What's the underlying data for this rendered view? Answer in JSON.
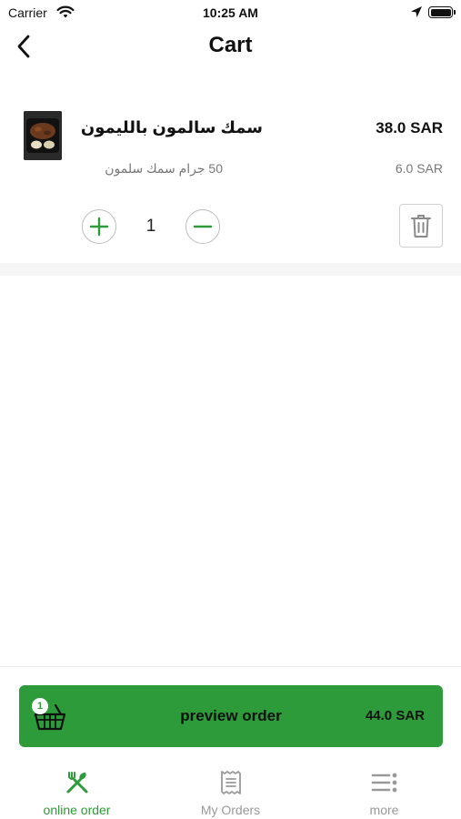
{
  "status_bar": {
    "carrier": "Carrier",
    "time": "10:25 AM",
    "icons": [
      "wifi-icon",
      "location-arrow-icon",
      "battery-icon"
    ]
  },
  "nav": {
    "title": "Cart",
    "back_icon": "chevron-left-icon"
  },
  "cart": {
    "items": [
      {
        "name": "سمك سالمون بالليمون",
        "price": "38.0 SAR",
        "addon": "50 جرام  سمك سلمون",
        "addon_price": "6.0 SAR",
        "quantity": "1"
      }
    ]
  },
  "preview": {
    "label": "preview order",
    "total": "44.0 SAR",
    "badge_count": "1",
    "icon": "basket-icon"
  },
  "tabs": [
    {
      "label": "online order",
      "icon": "fork-knife-icon",
      "active": true
    },
    {
      "label": "My Orders",
      "icon": "receipt-icon",
      "active": false
    },
    {
      "label": "more",
      "icon": "menu-dots-icon",
      "active": false
    }
  ],
  "colors": {
    "accent": "#2d9b3a",
    "text": "#111111",
    "muted": "#777777",
    "tab_inactive": "#999999"
  }
}
